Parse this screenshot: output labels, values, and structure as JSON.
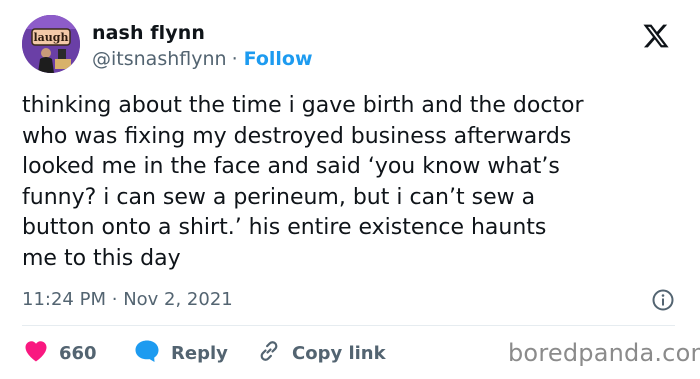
{
  "user": {
    "display_name": "nash flynn",
    "handle": "@itsnashflynn",
    "separator": "·",
    "follow_label": "Follow",
    "avatar_sign_text": "laugh"
  },
  "tweet": {
    "text": "thinking about the time i gave birth and the doctor\nwho was fixing my destroyed business afterwards\nlooked me in the face and said ‘you know what’s\nfunny? i can sew a perineum, but i can’t sew a\nbutton onto a shirt.’ his entire existence haunts\nme to this day",
    "time": "11:24 PM",
    "separator": "·",
    "date": "Nov 2, 2021"
  },
  "actions": {
    "like_count": "660",
    "reply_label": "Reply",
    "copy_link_label": "Copy link"
  },
  "watermark": "boredpanda.com",
  "icons": {
    "logo": "x-logo-icon",
    "info": "info-icon",
    "like": "heart-icon",
    "reply": "speech-bubble-icon",
    "copy": "link-icon"
  },
  "colors": {
    "accent": "#1d9bf0",
    "like": "#f91880",
    "text": "#0f1419",
    "secondary": "#536471",
    "divider": "#e6ecf0"
  }
}
